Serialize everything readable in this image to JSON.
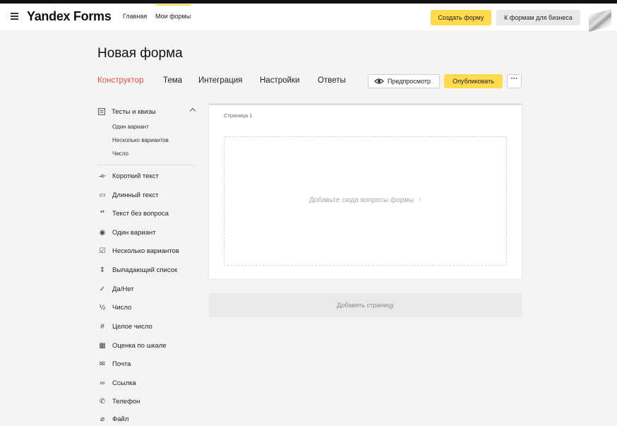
{
  "header": {
    "logo": "Yandex Forms",
    "nav": [
      {
        "label": "Главная"
      },
      {
        "label": "Мои формы"
      }
    ],
    "create_button": "Создать форму",
    "business_button": "К формам для бизнеса"
  },
  "page": {
    "title": "Новая форма",
    "tabs": [
      {
        "label": "Конструктор",
        "active": true
      },
      {
        "label": "Тема"
      },
      {
        "label": "Интеграция"
      },
      {
        "label": "Настройки"
      },
      {
        "label": "Ответы"
      }
    ],
    "preview_button": "Предпросмотр",
    "publish_button": "Опубликовать",
    "more_button": "···"
  },
  "sidebar": {
    "group": {
      "label": "Тесты и квизы",
      "icon": "quiz-icon",
      "items": [
        "Один вариант",
        "Несколько вариантов",
        "Число"
      ]
    },
    "items": [
      {
        "label": "Короткий текст",
        "icon": "short-text-icon"
      },
      {
        "label": "Длинный текст",
        "icon": "long-text-icon"
      },
      {
        "label": "Текст без вопроса",
        "icon": "text-no-question-icon"
      },
      {
        "label": "Один вариант",
        "icon": "radio-icon"
      },
      {
        "label": "Несколько вариантов",
        "icon": "checkbox-icon"
      },
      {
        "label": "Выпадающий список",
        "icon": "dropdown-icon"
      },
      {
        "label": "Да/Нет",
        "icon": "check-icon"
      },
      {
        "label": "Число",
        "icon": "fraction-icon"
      },
      {
        "label": "Целое число",
        "icon": "hash-icon"
      },
      {
        "label": "Оценка по шкале",
        "icon": "scale-grid-icon"
      },
      {
        "label": "Почта",
        "icon": "mail-icon"
      },
      {
        "label": "Ссылка",
        "icon": "link-icon"
      },
      {
        "label": "Телефон",
        "icon": "phone-icon"
      },
      {
        "label": "Файл",
        "icon": "paperclip-icon"
      }
    ]
  },
  "canvas": {
    "page_label": "Страница 1",
    "drop_hint": "Добавьте сюда вопросы формы",
    "add_page": "Добавить страницу"
  },
  "colors": {
    "accent_yellow": "#ffdb4d",
    "active_tab": "#e2524a"
  }
}
